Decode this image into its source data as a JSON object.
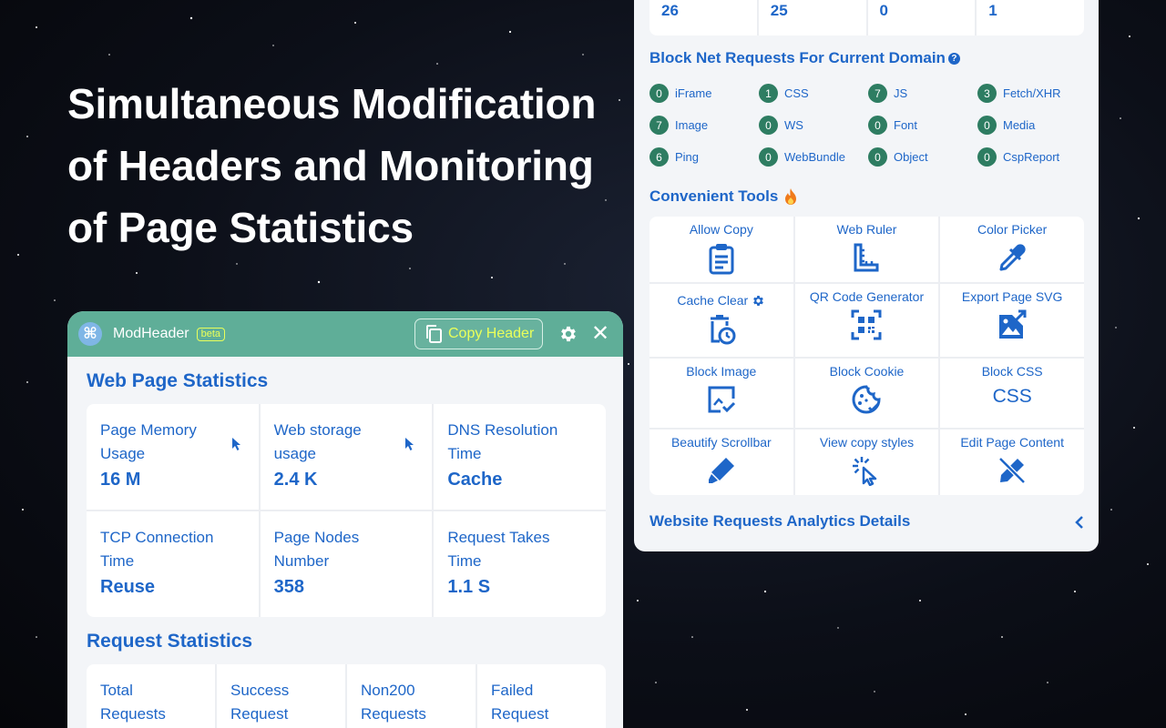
{
  "hero": {
    "line1": "Simultaneous Modification",
    "line2": "of Headers and Monitoring",
    "line3": "of Page Statistics"
  },
  "modheader": {
    "title": "ModHeader",
    "beta": "beta",
    "copy_button": "Copy Header"
  },
  "web_stats": {
    "title": "Web Page Statistics",
    "cells": [
      {
        "label": "Page Memory Usage",
        "value": "16 M"
      },
      {
        "label": "Web storage usage",
        "value": "2.4 K"
      },
      {
        "label": "DNS Resolution Time",
        "value": "Cache"
      },
      {
        "label": "TCP Connection Time",
        "value": "Reuse"
      },
      {
        "label": "Page Nodes Number",
        "value": "358"
      },
      {
        "label": "Request Takes Time",
        "value": "1.1 S"
      }
    ]
  },
  "request_stats": {
    "title": "Request Statistics",
    "cells": [
      {
        "label": "Total Requests"
      },
      {
        "label": "Success Request"
      },
      {
        "label": "Non200 Requests"
      },
      {
        "label": "Failed Request"
      }
    ]
  },
  "top_numbers": [
    "26",
    "25",
    "0",
    "1"
  ],
  "block": {
    "title": "Block Net Requests For Current Domain",
    "help": "?",
    "items": [
      {
        "count": "0",
        "label": "iFrame"
      },
      {
        "count": "1",
        "label": "CSS"
      },
      {
        "count": "7",
        "label": "JS"
      },
      {
        "count": "3",
        "label": "Fetch/XHR"
      },
      {
        "count": "7",
        "label": "Image"
      },
      {
        "count": "0",
        "label": "WS"
      },
      {
        "count": "0",
        "label": "Font"
      },
      {
        "count": "0",
        "label": "Media"
      },
      {
        "count": "6",
        "label": "Ping"
      },
      {
        "count": "0",
        "label": "WebBundle"
      },
      {
        "count": "0",
        "label": "Object"
      },
      {
        "count": "0",
        "label": "CspReport"
      }
    ]
  },
  "tools": {
    "title": "Convenient Tools",
    "items": [
      {
        "label": "Allow Copy",
        "icon": "clipboard-icon"
      },
      {
        "label": "Web Ruler",
        "icon": "ruler-icon"
      },
      {
        "label": "Color Picker",
        "icon": "eyedropper-icon"
      },
      {
        "label": "Cache Clear",
        "icon": "trash-clock-icon"
      },
      {
        "label": "QR Code Generator",
        "icon": "qr-code-icon"
      },
      {
        "label": "Export Page SVG",
        "icon": "image-export-icon"
      },
      {
        "label": "Block Image",
        "icon": "image-check-icon"
      },
      {
        "label": "Block Cookie",
        "icon": "cookie-icon"
      },
      {
        "label": "Block CSS",
        "icon": "css-text-icon",
        "text": "CSS"
      },
      {
        "label": "Beautify Scrollbar",
        "icon": "marker-icon"
      },
      {
        "label": "View copy styles",
        "icon": "cursor-click-icon"
      },
      {
        "label": "Edit Page Content",
        "icon": "edit-off-icon"
      }
    ]
  },
  "analytics": {
    "title": "Website Requests Analytics Details"
  },
  "colors": {
    "accent_blue": "#1e66c8",
    "header_green": "#5fae98",
    "badge_green": "#2e7d62",
    "beta_yellow": "#eaff5a"
  }
}
